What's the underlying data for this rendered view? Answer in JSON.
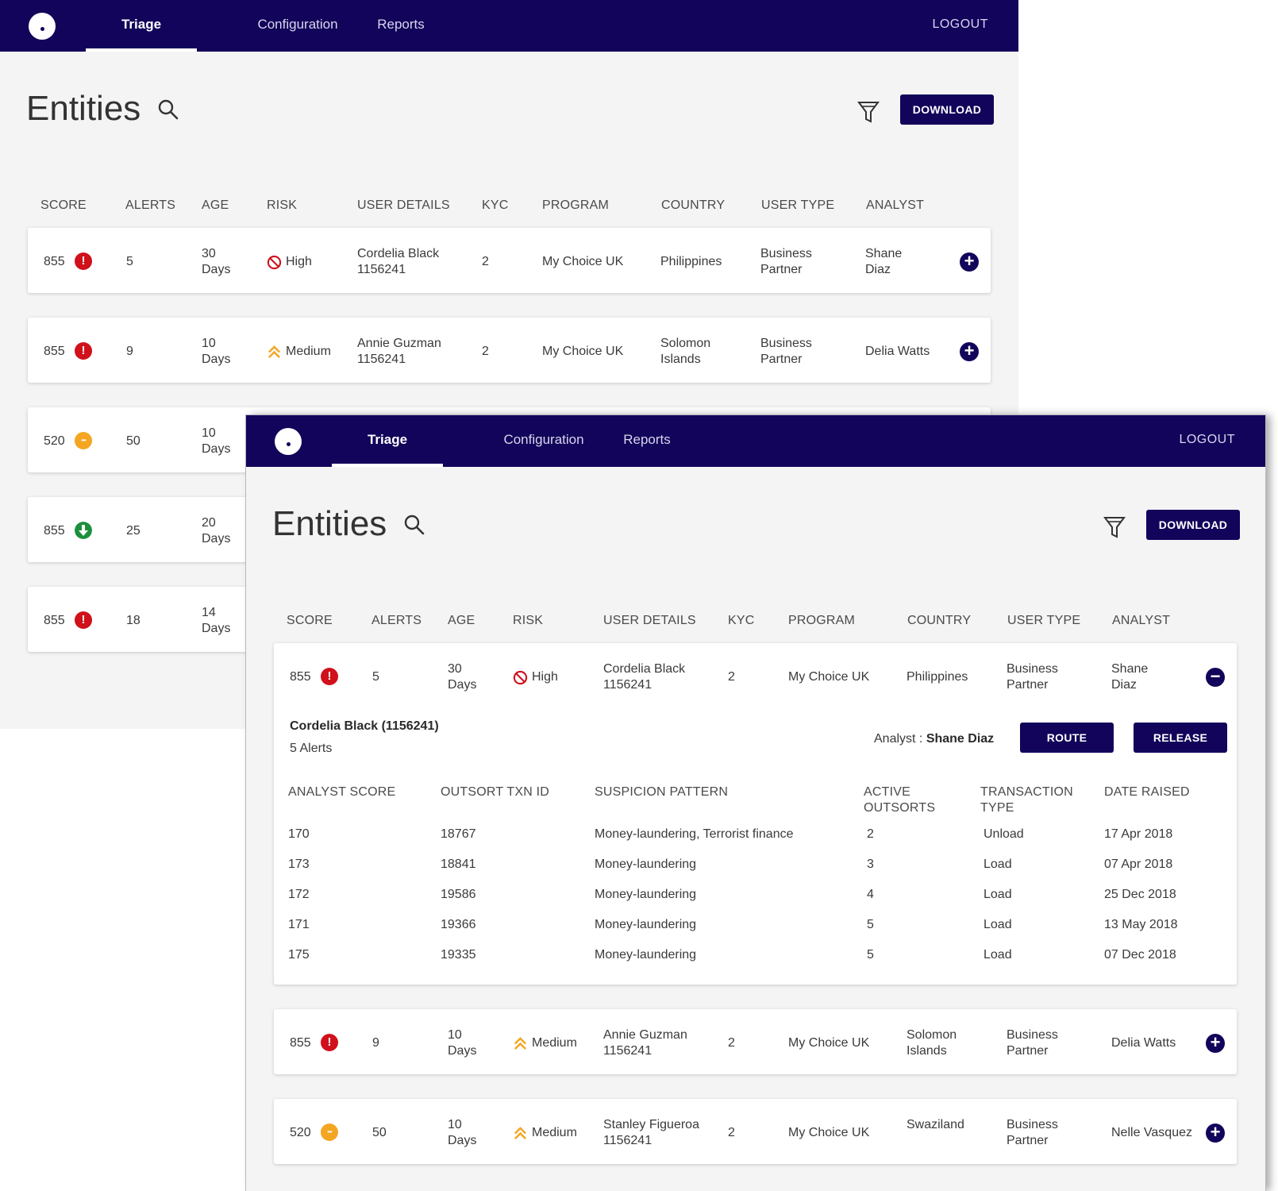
{
  "nav": {
    "triage": "Triage",
    "configuration": "Configuration",
    "reports": "Reports",
    "logout": "LOGOUT"
  },
  "page": {
    "title": "Entities",
    "download": "DOWNLOAD"
  },
  "columns": {
    "score": "SCORE",
    "alerts": "ALERTS",
    "age": "AGE",
    "risk": "RISK",
    "user_details": "USER DETAILS",
    "kyc": "KYC",
    "program": "PROGRAM",
    "country": "COUNTRY",
    "user_type": "USER TYPE",
    "analyst": "ANALYST"
  },
  "rows": [
    {
      "score": "855",
      "score_status": "alert",
      "alerts": "5",
      "age_num": "30",
      "age_unit": "Days",
      "risk": "High",
      "user_name": "Cordelia Black",
      "user_id": "1156241",
      "kyc": "2",
      "program": "My Choice UK",
      "country_1": "Philippines",
      "country_2": "",
      "user_type_1": "Business",
      "user_type_2": "Partner",
      "analyst_1": "Shane",
      "analyst_2": "Diaz"
    },
    {
      "score": "855",
      "score_status": "alert",
      "alerts": "9",
      "age_num": "10",
      "age_unit": "Days",
      "risk": "Medium",
      "user_name": "Annie Guzman",
      "user_id": "1156241",
      "kyc": "2",
      "program": "My Choice UK",
      "country_1": "Solomon",
      "country_2": "Islands",
      "user_type_1": "Business",
      "user_type_2": "Partner",
      "analyst_1": "Delia Watts",
      "analyst_2": ""
    },
    {
      "score": "520",
      "score_status": "pending",
      "alerts": "50",
      "age_num": "10",
      "age_unit": "Days",
      "risk": "Medium",
      "user_name": "Stanley Figueroa",
      "user_id": "1156241",
      "kyc": "2",
      "program": "My Choice UK",
      "country_1": "Swaziland",
      "country_2": "",
      "user_type_1": "Business",
      "user_type_2": "Partner",
      "analyst_1": "Nelle Vasquez",
      "analyst_2": ""
    },
    {
      "score": "855",
      "score_status": "down",
      "alerts": "25",
      "age_num": "20",
      "age_unit": "Days"
    },
    {
      "score": "855",
      "score_status": "alert",
      "alerts": "18",
      "age_num": "14",
      "age_unit": "Days"
    }
  ],
  "detail": {
    "title": "Cordelia Black (1156241)",
    "alerts_count": "5 Alerts",
    "analyst_label": "Analyst :",
    "analyst_name": "Shane Diaz",
    "route": "ROUTE",
    "release": "RELEASE",
    "columns": {
      "analyst_score": "ANALYST SCORE",
      "txn_id": "OUTSORT TXN ID",
      "pattern": "SUSPICION PATTERN",
      "active_1": "ACTIVE",
      "active_2": "OUTSORTS",
      "type_1": "TRANSACTION",
      "type_2": "TYPE",
      "date": "DATE RAISED"
    },
    "rows": [
      {
        "score": "170",
        "txn": "18767",
        "pattern": "Money-laundering, Terrorist finance",
        "active": "2",
        "type": "Unload",
        "date": "17 Apr 2018"
      },
      {
        "score": "173",
        "txn": "18841",
        "pattern": "Money-laundering",
        "active": "3",
        "type": "Load",
        "date": "07 Apr 2018"
      },
      {
        "score": "172",
        "txn": "19586",
        "pattern": "Money-laundering",
        "active": "4",
        "type": "Load",
        "date": "25 Dec 2018"
      },
      {
        "score": "171",
        "txn": "19366",
        "pattern": "Money-laundering",
        "active": "5",
        "type": "Load",
        "date": "13 May 2018"
      },
      {
        "score": "175",
        "txn": "19335",
        "pattern": "Money-laundering",
        "active": "5",
        "type": "Load",
        "date": "07 Dec 2018"
      }
    ]
  },
  "colors": {
    "nav_bg": "#11045a",
    "alert_red": "#d0101b",
    "pending_orange": "#f4a623",
    "down_green": "#1c8f3d",
    "page_bg": "#f4f4f5"
  }
}
